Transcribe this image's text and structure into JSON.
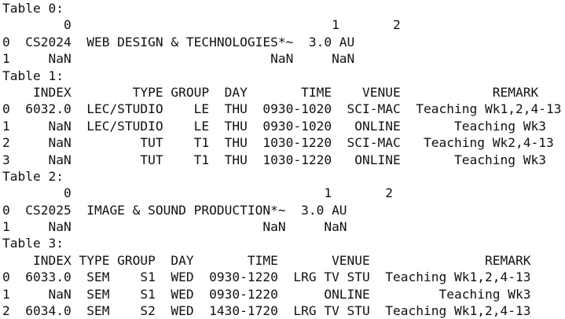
{
  "lines": [
    "Table 0:",
    "        0                                  1       2",
    "0  CS2024  WEB DESIGN & TECHNOLOGIES*~  3.0 AU",
    "1     NaN                          NaN     NaN",
    "Table 1:",
    "    INDEX        TYPE GROUP  DAY       TIME    VENUE            REMARK",
    "0  6032.0  LEC/STUDIO    LE  THU  0930-1020  SCI-MAC  Teaching Wk1,2,4-13",
    "1     NaN  LEC/STUDIO    LE  THU  0930-1020   ONLINE       Teaching Wk3",
    "2     NaN         TUT    T1  THU  1030-1220  SCI-MAC   Teaching Wk2,4-13",
    "3     NaN         TUT    T1  THU  1030-1220   ONLINE       Teaching Wk3",
    "Table 2:",
    "        0                                 1       2",
    "0  CS2025  IMAGE & SOUND PRODUCTION*~  3.0 AU",
    "1     NaN                         NaN     NaN",
    "Table 3:",
    "    INDEX TYPE GROUP  DAY       TIME       VENUE               REMARK",
    "0  6033.0  SEM    S1  WED  0930-1220  LRG TV STU  Teaching Wk1,2,4-13",
    "1     NaN  SEM    S1  WED  0930-1220      ONLINE         Teaching Wk3",
    "2  6034.0  SEM    S2  WED  1430-1720  LRG TV STU  Teaching Wk1,2,4-13"
  ]
}
